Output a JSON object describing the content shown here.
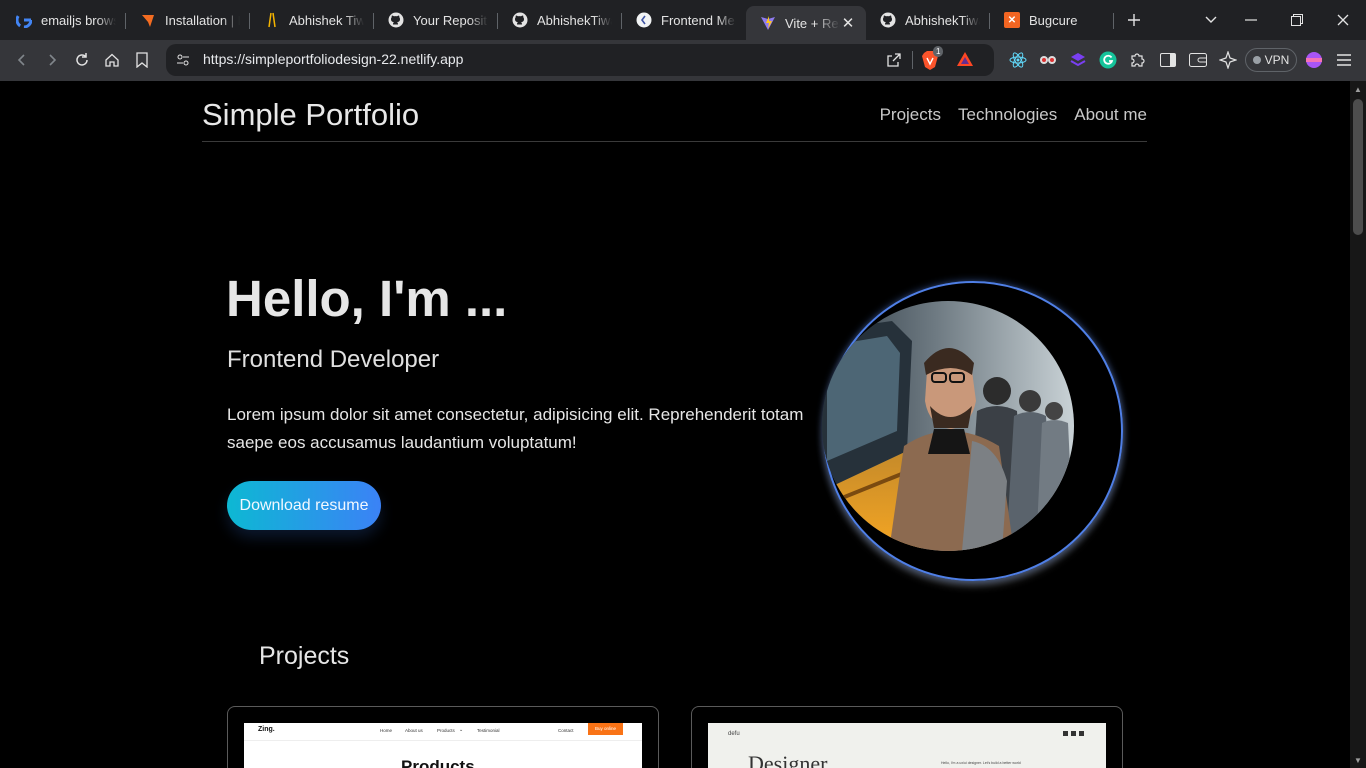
{
  "browser": {
    "tabs": [
      {
        "title": "emailjs browse",
        "icon": "google-icon"
      },
      {
        "title": "Installation | E",
        "icon": "orange-shape-icon"
      },
      {
        "title": "Abhishek Tiwa",
        "icon": "yellow-stroke-icon"
      },
      {
        "title": "Your Repositor",
        "icon": "github-icon"
      },
      {
        "title": "AbhishekTiwari",
        "icon": "github-icon"
      },
      {
        "title": "Frontend Men",
        "icon": "frontend-mentor-icon"
      },
      {
        "title": "Vite + React",
        "icon": "vite-icon",
        "active": true
      },
      {
        "title": "AbhishekTiwar",
        "icon": "github-icon"
      },
      {
        "title": "Bugcure",
        "icon": "bugcure-icon"
      }
    ],
    "url": "https://simpleportfoliodesign-22.netlify.app",
    "brave_badge": "1",
    "ext_badge": "4",
    "vpn_label": "VPN"
  },
  "site": {
    "brand": "Simple Portfolio",
    "nav": [
      "Projects",
      "Technologies",
      "About me"
    ],
    "hero": {
      "title": "Hello, I'm ...",
      "role": "Frontend Developer",
      "description": "Lorem ipsum dolor sit amet consectetur, adipisicing elit. Reprehenderit totam saepe eos accusamus laudantium voluptatum!",
      "cta": "Download resume"
    },
    "projects_title": "Projects",
    "projects": [
      {
        "preview_logo": "Zing.",
        "preview_nav": [
          "Home",
          "About us",
          "Products",
          "Testimonial",
          "Contact"
        ],
        "preview_cta": "Buy online",
        "preview_heading": "Products"
      },
      {
        "preview_logo": "defu",
        "preview_heading": "Designer",
        "preview_tagline": "Hello, I'm a ux/ui designer. Let's build a better world"
      }
    ]
  },
  "colors": {
    "accent_gradient_start": "#0db8d3",
    "accent_gradient_end": "#3b82f6",
    "ring": "#4f7fe6",
    "zing_cta": "#f97316"
  }
}
